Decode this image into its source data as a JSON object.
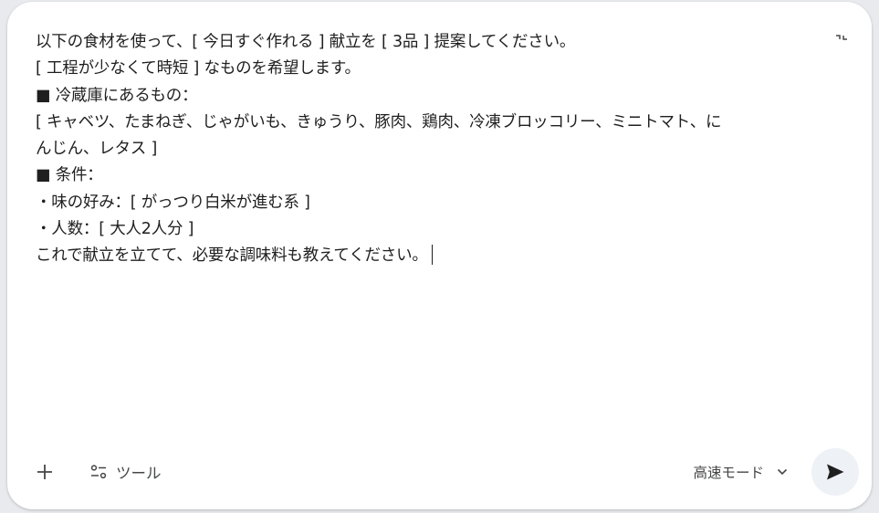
{
  "prompt": {
    "lines": [
      "以下の食材を使って、[ 今日すぐ作れる ] 献立を [ 3品 ] 提案してください。",
      "[ 工程が少なくて時短 ] なものを希望します。",
      "■ 冷蔵庫にあるもの：",
      "[ キャベツ、たまねぎ、じゃがいも、きゅうり、豚肉、鶏肉、冷凍ブロッコリー、ミニトマト、に",
      "んじん、レタス ]",
      "■ 条件：",
      "・味の好み：[ がっつり白米が進む系 ]",
      "・人数：[ 大人2人分 ]",
      "これで献立を立てて、必要な調味料も教えてください。"
    ]
  },
  "toolbar": {
    "add_icon": "plus-icon",
    "tools_icon": "tools-sliders-icon",
    "tools_label": "ツール",
    "mode_label": "高速モード",
    "mode_icon": "chevron-down-icon",
    "send_icon": "send-icon",
    "collapse_icon": "collapse-icon"
  },
  "colors": {
    "background": "#e8eaed",
    "card": "#ffffff",
    "text": "#1f1f1f",
    "muted_text": "#444746",
    "send_button_bg": "#eef1f5"
  }
}
